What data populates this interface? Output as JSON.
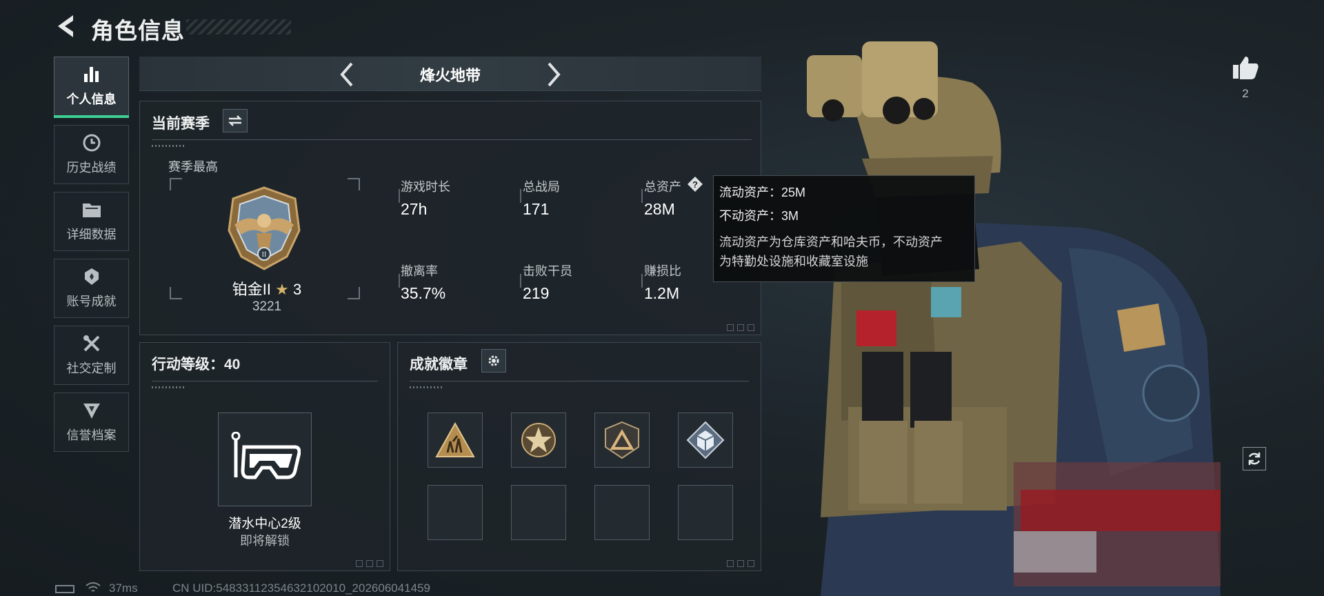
{
  "header": {
    "title": "角色信息"
  },
  "sidebar": {
    "items": [
      {
        "label": "个人信息",
        "icon": "bar-chart-icon",
        "active": true
      },
      {
        "label": "历史战绩",
        "icon": "clock-icon"
      },
      {
        "label": "详细数据",
        "icon": "folder-icon"
      },
      {
        "label": "账号成就",
        "icon": "trophy-icon"
      },
      {
        "label": "社交定制",
        "icon": "wrench-icon"
      },
      {
        "label": "信誉档案",
        "icon": "shield-icon"
      }
    ]
  },
  "mode": {
    "title": "烽火地带"
  },
  "season": {
    "title": "当前赛季",
    "best_label": "赛季最高",
    "rank_name": "铂金II",
    "rank_stars": "3",
    "rank_score": "3221",
    "stats": [
      {
        "label": "游戏时长",
        "value": "27h"
      },
      {
        "label": "总战局",
        "value": "171"
      },
      {
        "label": "总资产",
        "value": "28M"
      },
      {
        "label": "撤离率",
        "value": "35.7%"
      },
      {
        "label": "击败干员",
        "value": "219"
      },
      {
        "label": "赚损比",
        "value": "1.2M"
      }
    ]
  },
  "tooltip": {
    "liquid": "流动资产：25M",
    "fixed": "不动资产：3M",
    "desc_line1": "流动资产为仓库资产和哈夫币，不动资产",
    "desc_line2": "为特勤处设施和收藏室设施"
  },
  "action_level": {
    "title": "行动等级：40",
    "unlock_name": "潜水中心2级",
    "unlock_status": "即将解锁"
  },
  "badges": {
    "title": "成就徽章",
    "slots": [
      "soldiers-badge-icon",
      "star-badge-icon",
      "triangle-badge-icon",
      "cube-badge-icon",
      "",
      "",
      "",
      ""
    ]
  },
  "likes": {
    "count": "2"
  },
  "status_bar": {
    "ping": "37ms",
    "uid": "CN UID:548331123546321020​10_202606041459"
  },
  "colors": {
    "accent": "#3ecf96",
    "panel_border": "#3d484f"
  }
}
